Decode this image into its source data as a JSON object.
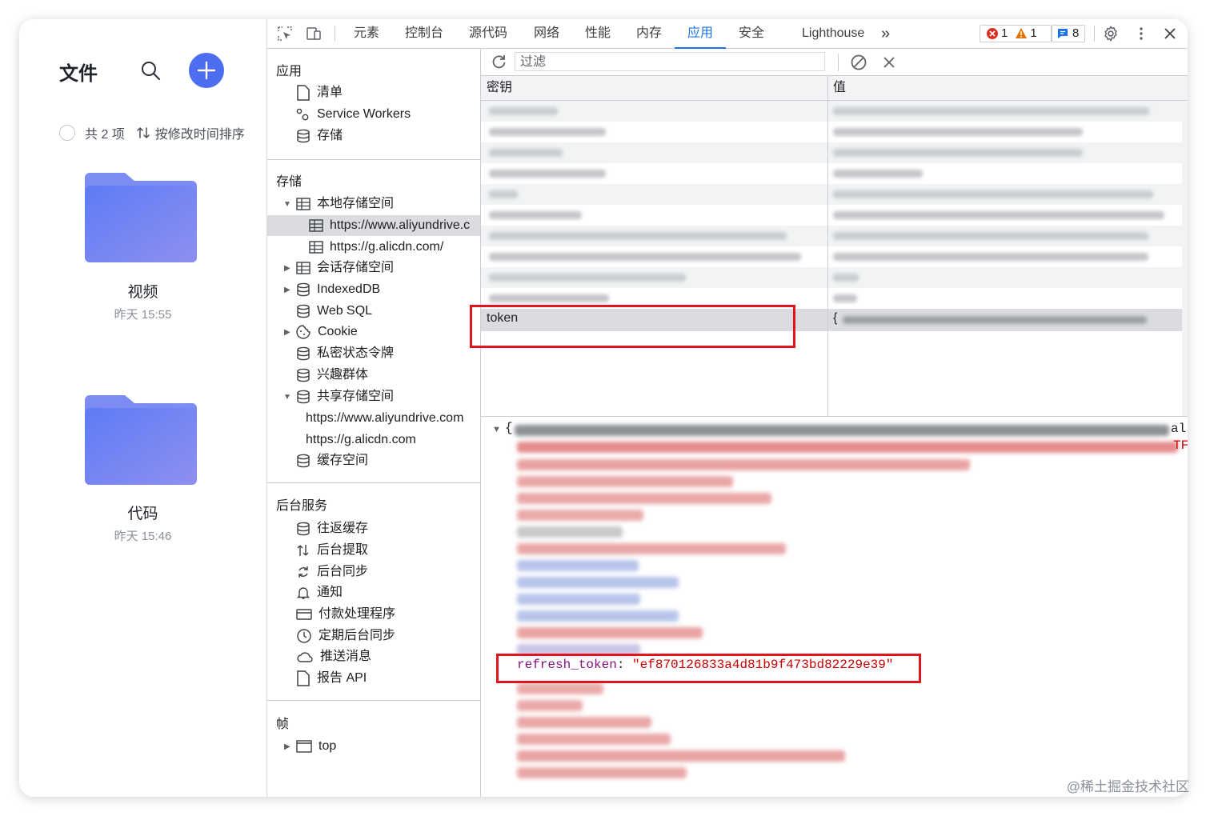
{
  "files": {
    "title": "文件",
    "count_label": "共 2 项",
    "sort_label": "按修改时间排序",
    "folders": [
      {
        "name": "视频",
        "time": "昨天 15:55"
      },
      {
        "name": "代码",
        "time": "昨天 15:46"
      }
    ]
  },
  "toolbar": {
    "tabs": [
      "元素",
      "控制台",
      "源代码",
      "网络",
      "性能",
      "内存",
      "应用",
      "安全",
      "Lighthouse"
    ],
    "active_tab": "应用",
    "more": "»",
    "errors": "1",
    "warnings": "1",
    "messages": "8"
  },
  "sidebar": {
    "app": {
      "title": "应用",
      "items": [
        "清单",
        "Service Workers",
        "存储"
      ]
    },
    "storage": {
      "title": "存储",
      "local_storage": "本地存储空间",
      "local_children": [
        "https://www.aliyundrive.c",
        "https://g.alicdn.com/"
      ],
      "session_storage": "会话存储空间",
      "indexeddb": "IndexedDB",
      "websql": "Web SQL",
      "cookie": "Cookie",
      "private_state": "私密状态令牌",
      "interest_groups": "兴趣群体",
      "shared_storage": "共享存储空间",
      "shared_children": [
        "https://www.aliyundrive.com",
        "https://g.alicdn.com"
      ],
      "cache_storage": "缓存空间"
    },
    "background": {
      "title": "后台服务",
      "items": [
        "往返缓存",
        "后台提取",
        "后台同步",
        "通知",
        "付款处理程序",
        "定期后台同步",
        "推送消息",
        "报告 API"
      ]
    },
    "frames": {
      "title": "帧",
      "top": "top"
    }
  },
  "main": {
    "filter_placeholder": "过滤",
    "col_key": "密钥",
    "col_value": "值",
    "selected_key": "token",
    "selected_value_prefix": "{",
    "json_open": "{",
    "json_tail_right": "als",
    "json_tail_right2": "TF",
    "refresh_key": "refresh_token",
    "refresh_colon": ": ",
    "refresh_value": "\"ef870126833a4d81b9f473bd82229e39\""
  },
  "colors": {
    "accent": "#1a73e8",
    "highlight": "#e0161c",
    "folder": "#6d7ff2"
  },
  "watermark": "@稀土掘金技术社区"
}
